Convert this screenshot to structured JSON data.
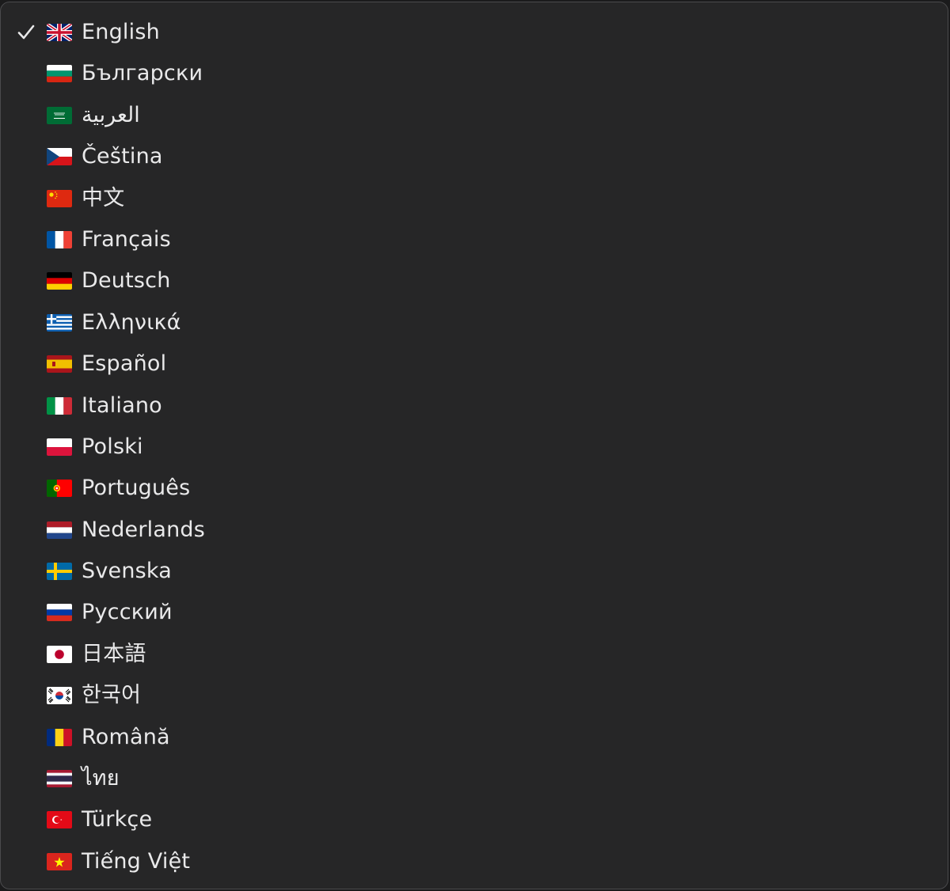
{
  "menu": {
    "title": "",
    "selected_index": 0,
    "items": [
      {
        "label": "English",
        "flag": "flag-gb-icon",
        "checked": true
      },
      {
        "label": "Български",
        "flag": "flag-bg-icon",
        "checked": false
      },
      {
        "label": "العربية",
        "flag": "flag-sa-icon",
        "checked": false
      },
      {
        "label": "Čeština",
        "flag": "flag-cz-icon",
        "checked": false
      },
      {
        "label": "中文",
        "flag": "flag-cn-icon",
        "checked": false
      },
      {
        "label": "Français",
        "flag": "flag-fr-icon",
        "checked": false
      },
      {
        "label": "Deutsch",
        "flag": "flag-de-icon",
        "checked": false
      },
      {
        "label": "Ελληνικά",
        "flag": "flag-gr-icon",
        "checked": false
      },
      {
        "label": "Español",
        "flag": "flag-es-icon",
        "checked": false
      },
      {
        "label": "Italiano",
        "flag": "flag-it-icon",
        "checked": false
      },
      {
        "label": "Polski",
        "flag": "flag-pl-icon",
        "checked": false
      },
      {
        "label": "Português",
        "flag": "flag-pt-icon",
        "checked": false
      },
      {
        "label": "Nederlands",
        "flag": "flag-nl-icon",
        "checked": false
      },
      {
        "label": "Svenska",
        "flag": "flag-se-icon",
        "checked": false
      },
      {
        "label": "Русский",
        "flag": "flag-ru-icon",
        "checked": false
      },
      {
        "label": "日本語",
        "flag": "flag-jp-icon",
        "checked": false
      },
      {
        "label": "한국어",
        "flag": "flag-kr-icon",
        "checked": false
      },
      {
        "label": "Română",
        "flag": "flag-ro-icon",
        "checked": false
      },
      {
        "label": "ไทย",
        "flag": "flag-th-icon",
        "checked": false
      },
      {
        "label": "Türkçe",
        "flag": "flag-tr-icon",
        "checked": false
      },
      {
        "label": "Tiếng Việt",
        "flag": "flag-vn-icon",
        "checked": false
      }
    ]
  },
  "colors": {
    "menu_background": "#262627",
    "menu_border": "#4a4a4c",
    "text": "#e9e9ea",
    "check": "#e9e9ea"
  }
}
